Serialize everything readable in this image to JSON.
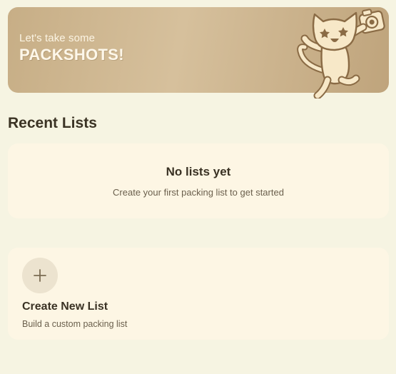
{
  "hero": {
    "tagline": "Let's take some",
    "headline": "PACKSHOTS!",
    "mascot_icon": "cat-with-camera-icon"
  },
  "recent": {
    "title": "Recent Lists",
    "empty_title": "No lists yet",
    "empty_subtitle": "Create your first packing list to get started"
  },
  "create": {
    "icon": "plus-icon",
    "title": "Create New List",
    "subtitle": "Build a custom packing list"
  },
  "colors": {
    "background": "#f6f4e2",
    "card": "#fdf6e4",
    "hero_gradient_start": "#c7ae86",
    "hero_gradient_end": "#bfa47c",
    "text_dark": "#3a3224",
    "text_muted": "#6b604d"
  }
}
